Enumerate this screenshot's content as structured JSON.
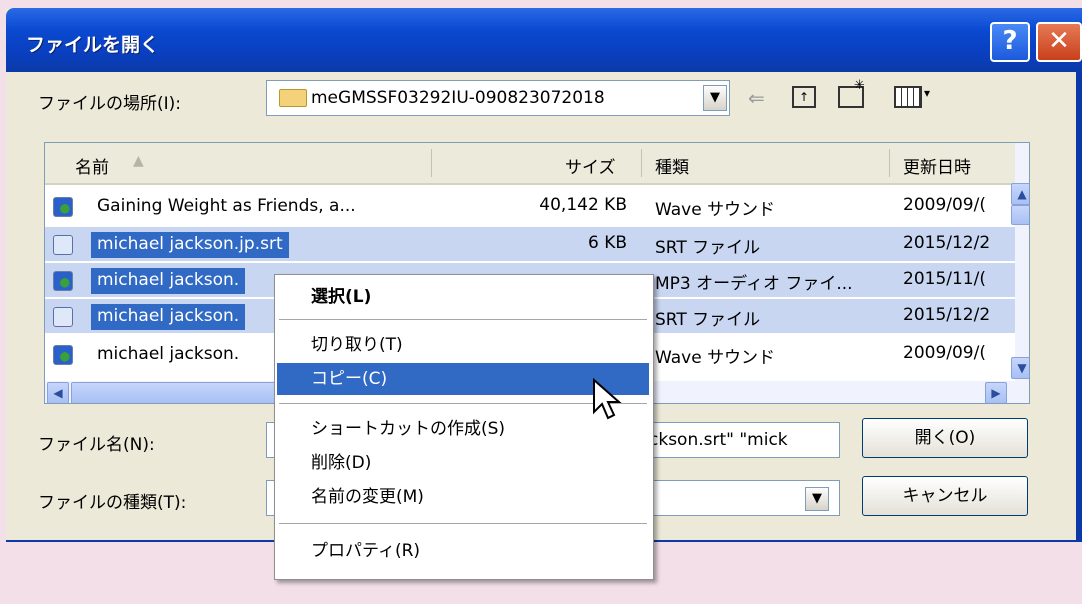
{
  "window": {
    "title": "ファイルを開く",
    "help": "?",
    "close": "✕"
  },
  "lookin": {
    "label": "ファイルの場所(I):",
    "value": "meGMSSF03292IU-090823072018",
    "toolbar": [
      "back-arrow-icon",
      "up-folder-icon",
      "new-folder-icon",
      "views-menu-icon"
    ]
  },
  "columns": {
    "name": "名前",
    "size": "サイズ",
    "type": "種類",
    "modified": "更新日時"
  },
  "files": [
    {
      "name": "Gaining Weight as Friends, a...",
      "size": "40,142 KB",
      "type": "Wave サウンド",
      "modified": "2009/09/(",
      "icon": "audio-file-icon"
    },
    {
      "name": "michael jackson.jp.srt",
      "size": "6 KB",
      "type": "SRT ファイル",
      "modified": "2015/12/2",
      "icon": "document-file-icon"
    },
    {
      "name": "michael jackson.",
      "size": "",
      "type": "MP3 オーディオ ファイ...",
      "modified": "2015/11/(",
      "icon": "audio-file-icon"
    },
    {
      "name": "michael jackson.",
      "size": "",
      "type": "SRT ファイル",
      "modified": "2015/12/2",
      "icon": "document-file-icon"
    },
    {
      "name": "michael jackson.",
      "size": "",
      "type": "Wave サウンド",
      "modified": "2009/09/(",
      "icon": "audio-file-icon"
    }
  ],
  "filename": {
    "label": "ファイル名(N):",
    "value": "ckson.srt\" \"mick"
  },
  "filetype": {
    "label": "ファイルの種類(T):",
    "value": ""
  },
  "buttons": {
    "open": "開く(O)",
    "cancel": "キャンセル"
  },
  "context_menu": {
    "select": "選択(L)",
    "cut": "切り取り(T)",
    "copy": "コピー(C)",
    "shortcut": "ショートカットの作成(S)",
    "delete": "削除(D)",
    "rename": "名前の変更(M)",
    "properties": "プロパティ(R)"
  },
  "colors": {
    "titlebar": "#0a49d0",
    "selection": "#316ac5",
    "dialog_bg": "#ece9d8"
  }
}
